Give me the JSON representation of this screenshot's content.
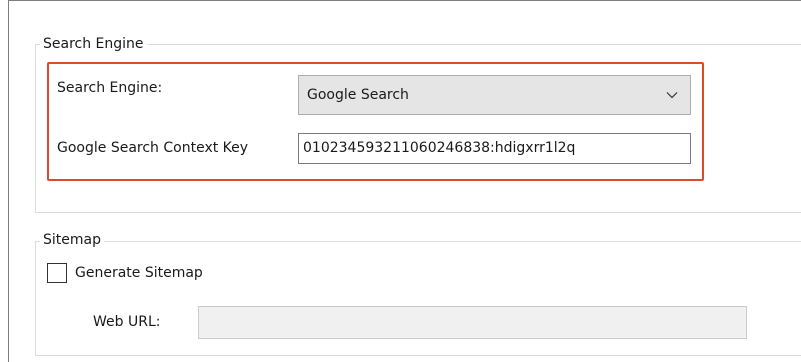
{
  "search_engine_group": {
    "legend": "Search Engine",
    "engine_label": "Search Engine:",
    "engine_selected": "Google Search",
    "context_key_label": "Google Search Context Key",
    "context_key_value": "010234593211060246838:hdigxrr1l2q"
  },
  "sitemap_group": {
    "legend": "Sitemap",
    "generate_label": "Generate Sitemap",
    "generate_checked": false,
    "web_url_label": "Web URL:",
    "web_url_value": ""
  },
  "colors": {
    "highlight_border": "#dd4b2a",
    "combobox_bg": "#e5e5e5",
    "disabled_input_bg": "#f0f0f0"
  }
}
